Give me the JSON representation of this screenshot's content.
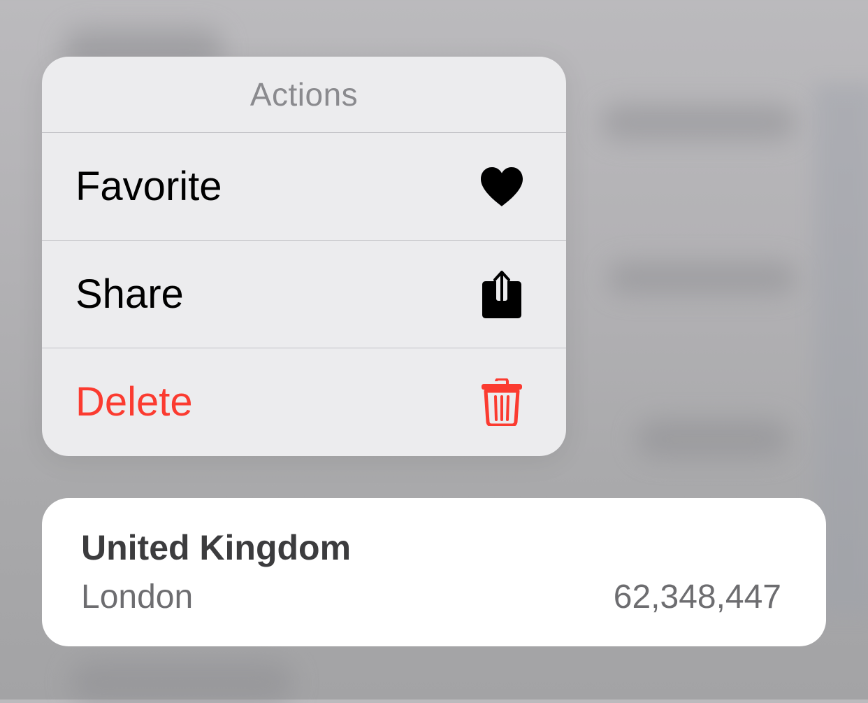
{
  "menu": {
    "title": "Actions",
    "items": [
      {
        "label": "Favorite",
        "icon": "heart-icon",
        "destructive": false
      },
      {
        "label": "Share",
        "icon": "share-icon",
        "destructive": false
      },
      {
        "label": "Delete",
        "icon": "trash-icon",
        "destructive": true
      }
    ]
  },
  "card": {
    "title": "United Kingdom",
    "subtitle": "London",
    "value": "62,348,447"
  },
  "colors": {
    "destructive": "#fb3b30",
    "menu_background": "#ececee",
    "card_background": "#ffffff"
  }
}
